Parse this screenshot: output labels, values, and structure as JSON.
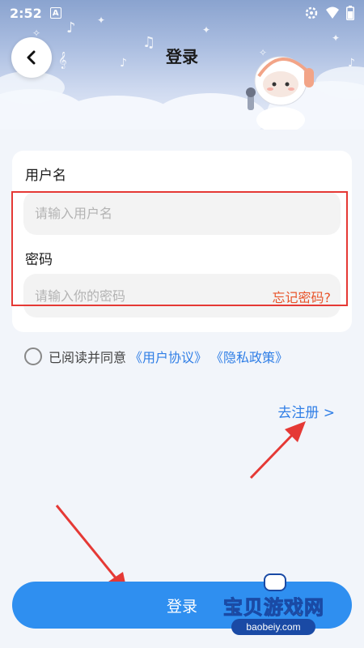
{
  "status_bar": {
    "time": "2:52",
    "app_icon": "A"
  },
  "header": {
    "title": "登录",
    "back_icon": "chevron-left-icon"
  },
  "form": {
    "username_label": "用户名",
    "username_placeholder": "请输入用户名",
    "password_label": "密码",
    "password_placeholder": "请输入你的密码",
    "forgot_password": "忘记密码?"
  },
  "agreement": {
    "text": "已阅读并同意",
    "user_agreement": "《用户协议》",
    "privacy_policy": "《隐私政策》"
  },
  "register_link": "去注册 >",
  "login_button": "登录",
  "watermark": {
    "brand": "宝贝游戏网",
    "url": "baobeiy.com"
  },
  "colors": {
    "accent": "#2f8ff0",
    "link": "#2f7ee6",
    "forgot": "#e8542a",
    "annotation": "#e53935"
  }
}
